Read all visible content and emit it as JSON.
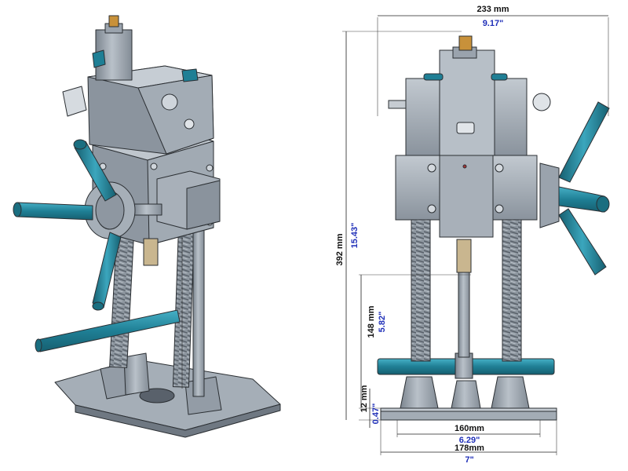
{
  "colors": {
    "metal": "#9aa3ad",
    "metal_light": "#c4cbd2",
    "metal_dark": "#6d7680",
    "outline": "#2b2f33",
    "handle": "#1f7f95",
    "handle_light": "#3ba6bd",
    "brass": "#c8913a",
    "dim_black": "#111111",
    "dim_blue": "#1f2fb8"
  },
  "icons": {
    "iso_view": "drill-press-stand-isometric-drawing",
    "front_view": "drill-press-stand-front-elevation-drawing"
  },
  "dimensions": {
    "overall_width": {
      "mm": "233 mm",
      "in": "9.17\""
    },
    "overall_height": {
      "mm": "392 mm",
      "in": "15.43\""
    },
    "column_height": {
      "mm": "148 mm",
      "in": "5.82\""
    },
    "base_thickness": {
      "mm": "12 mm",
      "in": "0.47\""
    },
    "inner_width": {
      "mm": "160mm",
      "in": "6.29\""
    },
    "base_width": {
      "mm": "178mm",
      "in": "7\""
    }
  }
}
